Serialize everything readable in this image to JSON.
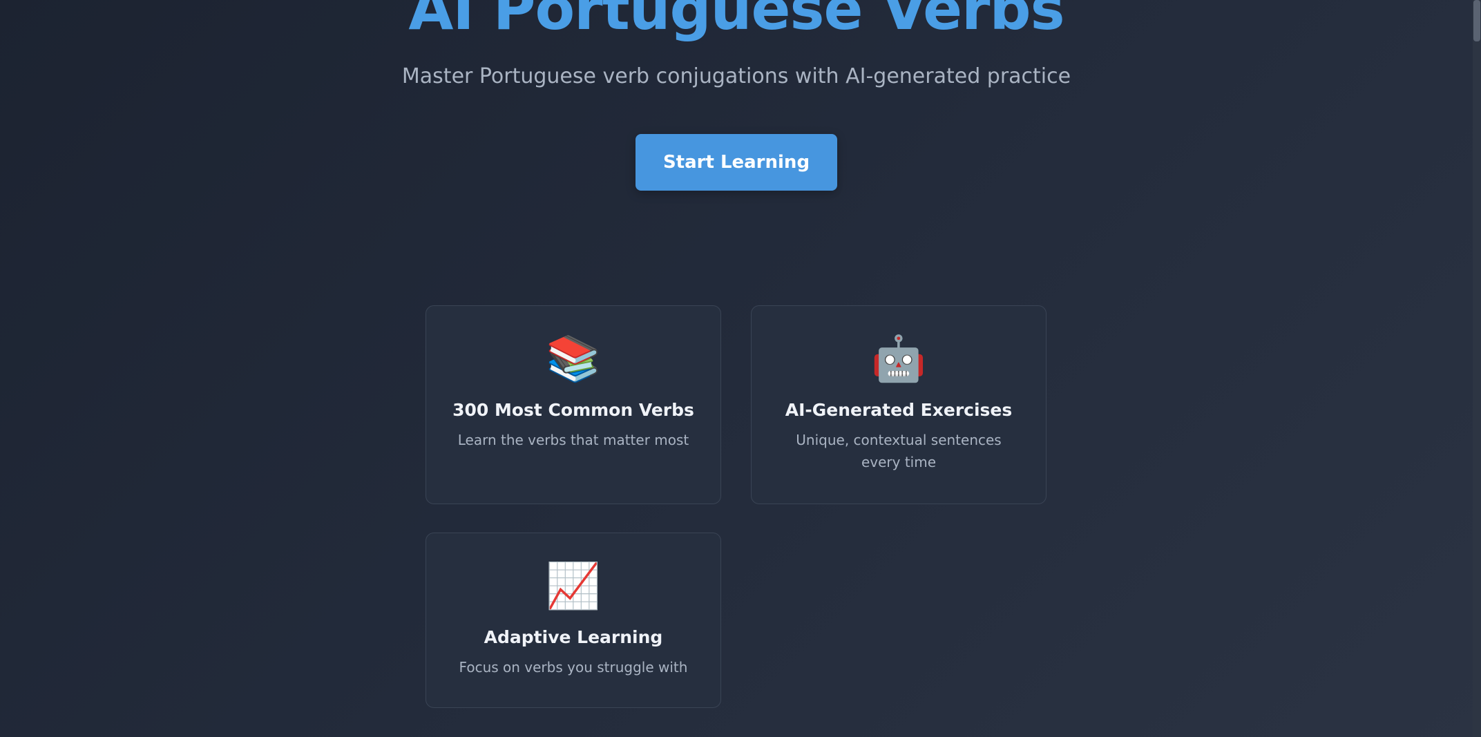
{
  "hero": {
    "title": "AI Portuguese Verbs",
    "subtitle": "Master Portuguese verb conjugations with AI-generated practice",
    "cta_label": "Start Learning"
  },
  "features": [
    {
      "icon": "books-icon",
      "emoji": "📚",
      "title": "300 Most Common Verbs",
      "description": "Learn the verbs that matter most"
    },
    {
      "icon": "robot-icon",
      "emoji": "🤖",
      "title": "AI-Generated Exercises",
      "description": "Unique, contextual sentences every time"
    },
    {
      "icon": "chart-increasing-icon",
      "emoji": "📈",
      "title": "Adaptive Learning",
      "description": "Focus on verbs you struggle with"
    }
  ],
  "colors": {
    "accent": "#4a9ee6",
    "button": "#4796df",
    "card_bg": "#262f3f",
    "background": "#1c2331"
  }
}
